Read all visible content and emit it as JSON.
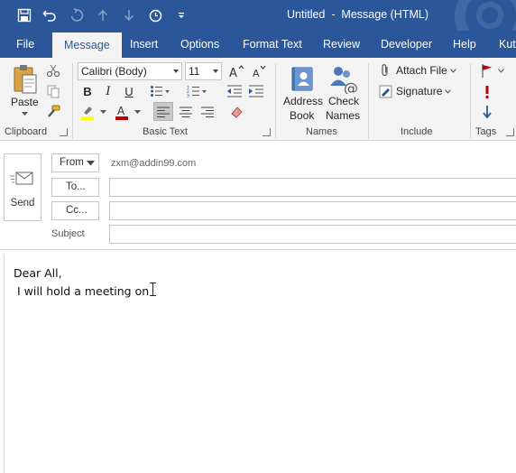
{
  "window": {
    "title": "Untitled  -  Message (HTML)"
  },
  "quick_access": {
    "icons": [
      "save-icon",
      "undo-icon",
      "redo-icon",
      "arrow-up-icon",
      "arrow-down-icon",
      "clock-icon",
      "customize-icon"
    ]
  },
  "tabs": [
    {
      "label": "File"
    },
    {
      "label": "Message"
    },
    {
      "label": "Insert"
    },
    {
      "label": "Options"
    },
    {
      "label": "Format Text"
    },
    {
      "label": "Review"
    },
    {
      "label": "Developer"
    },
    {
      "label": "Help"
    },
    {
      "label": "Kut"
    }
  ],
  "ribbon": {
    "clipboard": {
      "paste_label": "Paste",
      "group_label": "Clipboard"
    },
    "basic_text": {
      "font_name": "Calibri (Body)",
      "font_size": "11",
      "bold": "B",
      "italic": "I",
      "underline": "U",
      "group_label": "Basic Text"
    },
    "names": {
      "address_book_line1": "Address",
      "address_book_line2": "Book",
      "check_names_line1": "Check",
      "check_names_line2": "Names",
      "group_label": "Names"
    },
    "include": {
      "attach_file": "Attach File",
      "signature": "Signature",
      "group_label": "Include"
    },
    "tags": {
      "group_label": "Tags"
    }
  },
  "header": {
    "send_label": "Send",
    "from_label": "From",
    "from_address": "zxm@addin99.com",
    "to_label": "To...",
    "cc_label": "Cc...",
    "subject_label": "Subject",
    "to_value": "",
    "cc_value": "",
    "subject_value": ""
  },
  "body": {
    "line1": "Dear All,",
    "line2": " I will hold a meeting on "
  },
  "colors": {
    "brand": "#2b579a",
    "highlight": "#ffff00",
    "font_color": "#c00000",
    "flag_red": "#c00000"
  }
}
